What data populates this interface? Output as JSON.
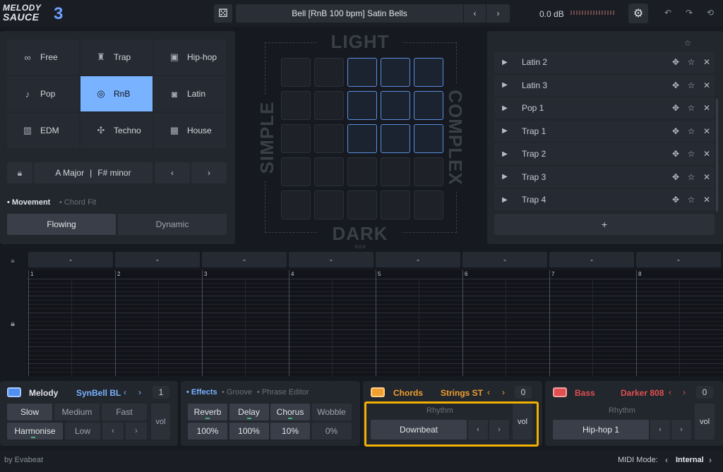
{
  "app": {
    "logo_top": "MELODY",
    "logo_bottom": "SAUCE",
    "logo_num": "3",
    "footer": "by Evabeat"
  },
  "topbar": {
    "preset_title": "Bell  [RnB 100 bpm]  Satin Bells",
    "db": "0.0 dB"
  },
  "genres": [
    {
      "label": "Free",
      "icon": "infinity-icon"
    },
    {
      "label": "Trap",
      "icon": "hoodie-icon"
    },
    {
      "label": "Hip-hop",
      "icon": "boombox-icon"
    },
    {
      "label": "Pop",
      "icon": "guitar-icon"
    },
    {
      "label": "RnB",
      "icon": "vinyl-icon",
      "selected": true
    },
    {
      "label": "Latin",
      "icon": "speaker-icon"
    },
    {
      "label": "EDM",
      "icon": "equalizer-icon"
    },
    {
      "label": "Techno",
      "icon": "techno-icon"
    },
    {
      "label": "House",
      "icon": "piano-icon"
    }
  ],
  "key": {
    "major": "A Major",
    "separator": "|",
    "minor": "F# minor"
  },
  "movement": {
    "tab_active": "Movement",
    "tab_inactive": "Chord Fit",
    "options": [
      "Flowing",
      "Dynamic"
    ]
  },
  "pad": {
    "top": "LIGHT",
    "bottom": "DARK",
    "left": "SIMPLE",
    "right": "COMPLEX",
    "version": "3.0.0"
  },
  "presets": {
    "items": [
      "Latin 2",
      "Latin 3",
      "Pop 1",
      "Trap 1",
      "Trap 2",
      "Trap 3",
      "Trap 4"
    ],
    "add_label": "+"
  },
  "timeline": {
    "slots": [
      "-",
      "-",
      "-",
      "-",
      "-",
      "-",
      "-",
      "-"
    ],
    "bars": [
      "1",
      "2",
      "3",
      "4",
      "5",
      "6",
      "7",
      "8"
    ]
  },
  "melody": {
    "label": "Melody",
    "instrument": "SynBell BL",
    "octave": "1",
    "speed": [
      "Slow",
      "Medium",
      "Fast"
    ],
    "harmonise": "Harmonise",
    "level": "Low",
    "vol": "vol"
  },
  "effects": {
    "tabs": [
      "Effects",
      "Groove",
      "Phrase Editor"
    ],
    "names": [
      "Reverb",
      "Delay",
      "Chorus",
      "Wobble"
    ],
    "values": [
      "100%",
      "100%",
      "10%",
      "0%"
    ]
  },
  "chords": {
    "label": "Chords",
    "instrument": "Strings ST",
    "octave": "0",
    "rhythm_label": "Rhythm",
    "rhythm": "Downbeat",
    "vol": "vol"
  },
  "bass": {
    "label": "Bass",
    "instrument": "Darker 808",
    "octave": "0",
    "rhythm_label": "Rhythm",
    "rhythm": "Hip-hop 1",
    "vol": "vol"
  },
  "midi": {
    "label": "MIDI Mode:",
    "value": "Internal"
  },
  "colors": {
    "accent_blue": "#79b2ff",
    "melody": "#4f8ff0",
    "chords": "#f0a030",
    "bass": "#e05050",
    "highlight": "#f2b000"
  }
}
